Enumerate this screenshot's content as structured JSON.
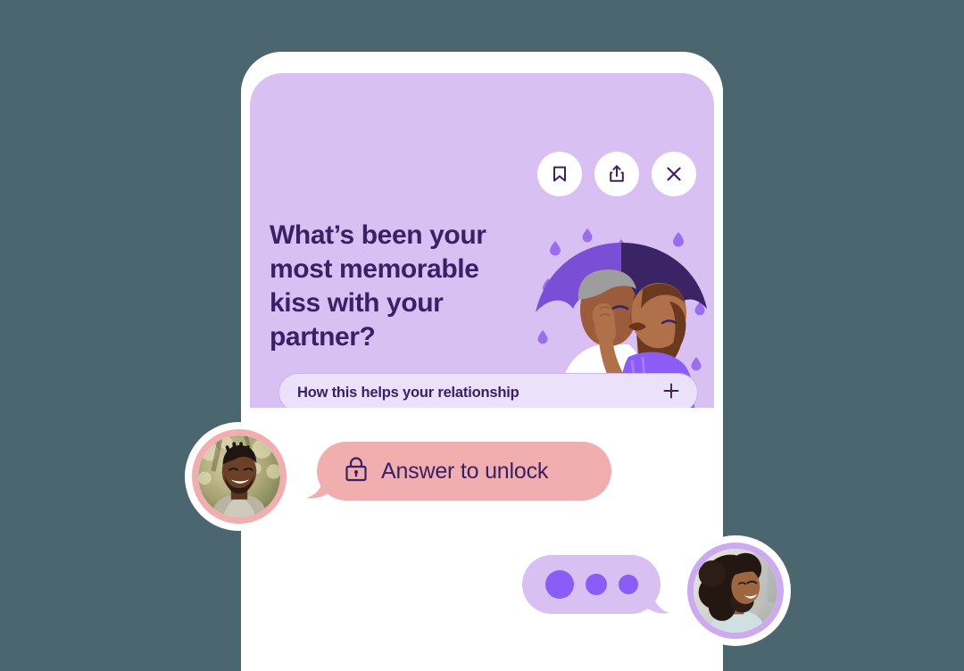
{
  "theme": {
    "page_background": "#4c6670",
    "card_purple": "#d9c0f2",
    "text_dark_purple": "#3b2066",
    "bubble_pink": "#f0aeae",
    "bubble_lilac": "#d9c0f2",
    "dot_purple": "#8b5cf6",
    "expander_bg": "#ece1fa",
    "avatar_ring_pink": "#f0aeae",
    "avatar_ring_lilac": "#cbaaf0",
    "umbrella_light": "#7c4dd6",
    "umbrella_dark": "#3a2466",
    "raindrop": "#9b6ef0"
  },
  "card": {
    "title": "What’s been your most memorable kiss with your partner?",
    "actions": [
      {
        "name": "bookmark-button",
        "icon": "bookmark-icon",
        "label": "Bookmark"
      },
      {
        "name": "share-button",
        "icon": "share-icon",
        "label": "Share"
      },
      {
        "name": "close-button",
        "icon": "close-icon",
        "label": "Close"
      }
    ],
    "illustration_alt": "couple kissing under an umbrella in the rain",
    "expander": {
      "label": "How this helps your relationship",
      "icon": "plus-icon"
    }
  },
  "chat": {
    "locked_message": {
      "icon": "lock-icon",
      "text": "Answer to unlock",
      "sender_avatar": "partner-avatar-left"
    },
    "typing_indicator": {
      "dots": 3,
      "sender_avatar": "partner-avatar-right"
    }
  }
}
